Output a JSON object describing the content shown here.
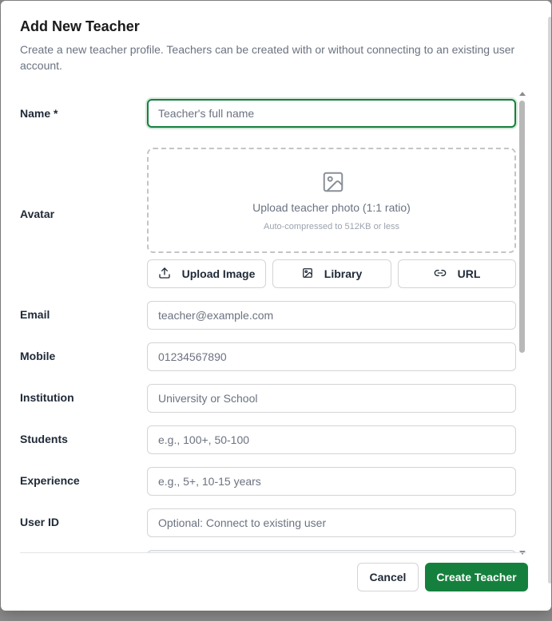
{
  "dialog": {
    "title": "Add New Teacher",
    "description": "Create a new teacher profile. Teachers can be created with or without connecting to an existing user account."
  },
  "form": {
    "name": {
      "label": "Name *",
      "placeholder": "Teacher's full name"
    },
    "avatar": {
      "label": "Avatar",
      "upload_text": "Upload teacher photo (1:1 ratio)",
      "upload_hint": "Auto-compressed to 512KB or less",
      "upload_button": "Upload Image",
      "library_button": "Library",
      "url_button": "URL"
    },
    "email": {
      "label": "Email",
      "placeholder": "teacher@example.com"
    },
    "mobile": {
      "label": "Mobile",
      "placeholder": "01234567890"
    },
    "institution": {
      "label": "Institution",
      "placeholder": "University or School"
    },
    "students": {
      "label": "Students",
      "placeholder": "e.g., 100+, 50-100"
    },
    "experience": {
      "label": "Experience",
      "placeholder": "e.g., 5+, 10-15 years"
    },
    "user_id": {
      "label": "User ID",
      "placeholder": "Optional: Connect to existing user"
    }
  },
  "footer": {
    "cancel_label": "Cancel",
    "create_label": "Create Teacher"
  },
  "colors": {
    "primary": "#15803d",
    "focus_ring": "#15803d",
    "placeholder": "#6b7280"
  },
  "icons": {
    "image": "image-icon",
    "upload": "upload-icon",
    "library": "gallery-icon",
    "url": "link-icon"
  }
}
